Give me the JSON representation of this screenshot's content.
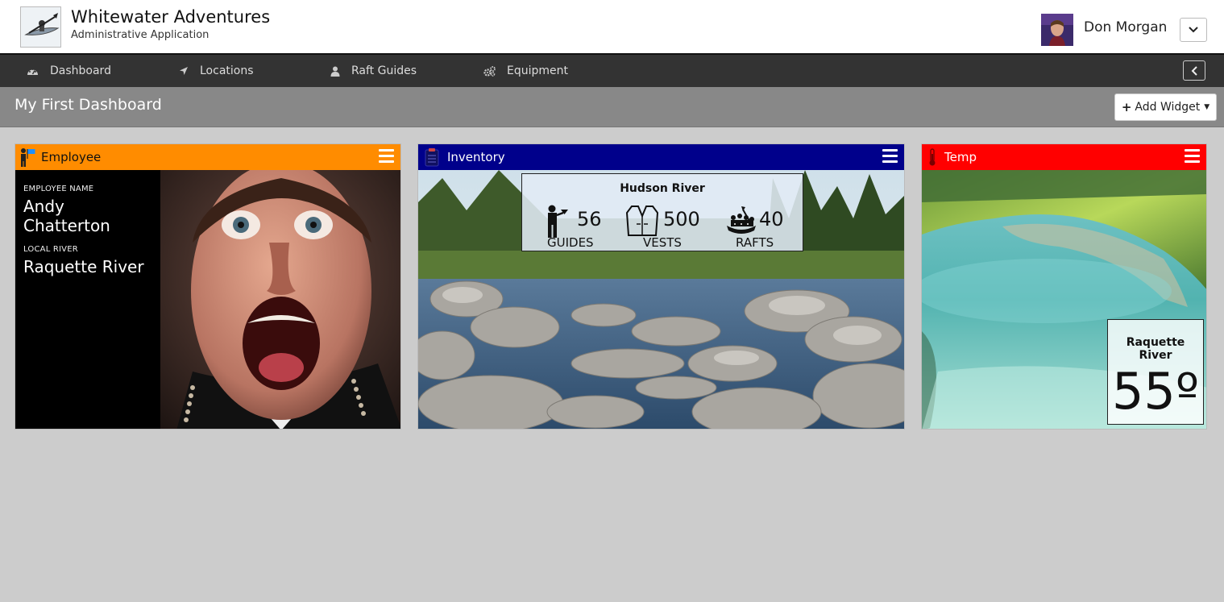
{
  "app": {
    "title": "Whitewater Adventures",
    "subtitle": "Administrative Application",
    "logo_icon": "kayak-logo"
  },
  "user": {
    "name": "Don Morgan",
    "avatar_icon": "user-avatar",
    "dropdown_icon": "chevron-down-icon"
  },
  "nav": {
    "items": [
      {
        "label": "Dashboard",
        "icon": "dashboard-icon"
      },
      {
        "label": "Locations",
        "icon": "location-arrow-icon"
      },
      {
        "label": "Raft Guides",
        "icon": "user-icon"
      },
      {
        "label": "Equipment",
        "icon": "gears-icon"
      }
    ],
    "collapse_icon": "chevron-left-icon"
  },
  "page": {
    "title": "My First Dashboard",
    "add_widget_label": "Add Widget"
  },
  "colors": {
    "employee_header": "#ff8c00",
    "inventory_header": "#00008b",
    "temp_header": "#ff0000",
    "nav_bg": "#333333",
    "titlebar_bg": "#888888"
  },
  "widgets": {
    "employee": {
      "title": "Employee",
      "name_label": "EMPLOYEE NAME",
      "name": "Andy Chatterton",
      "river_label": "LOCAL RIVER",
      "river": "Raquette River"
    },
    "inventory": {
      "title": "Inventory",
      "river": "Hudson River",
      "stats": [
        {
          "value": "56",
          "label": "GUIDES",
          "icon": "guide-icon"
        },
        {
          "value": "500",
          "label": "VESTS",
          "icon": "vest-icon"
        },
        {
          "value": "40",
          "label": "RAFTS",
          "icon": "raft-icon"
        }
      ]
    },
    "temp": {
      "title": "Temp",
      "river": "Raquette River",
      "value": "55º"
    }
  }
}
